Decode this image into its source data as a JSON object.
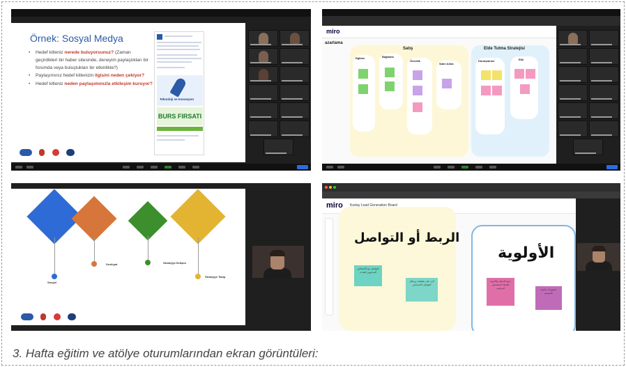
{
  "caption": "3. Hafta eğitim ve atölye oturumlarından ekran görüntüleri:",
  "shot1": {
    "title_prefix": "Örnek:",
    "title_main": "Sosyal Medya",
    "bullets": [
      {
        "pre": "Hedef kitleniz ",
        "hl": "nerede buluyorsunuz?",
        "post": " (Zaman geçirdikleri bir haber sitesinde, deneyim paylaştıkları bir forumda veya buluştukları bir etkinlikte?)"
      },
      {
        "pre": "Paylaşımınız hedef kitlenizin ",
        "hl": "ilgisini neden çekiyor?",
        "post": ""
      },
      {
        "pre": "Hedef kitleniz ",
        "hl": "neden paylaşımınızla etkileşim kuruyor?",
        "post": ""
      }
    ],
    "post_rocket_text": "Teknoloji ve Inovasyon",
    "post_banner": "BURS FIRSATI"
  },
  "shot2": {
    "logo": "miro",
    "columns": [
      "Satış",
      "Elde Tutma Stratejisi"
    ],
    "subcolumns": [
      "Eğitme",
      "Bağlama",
      "Önerilik",
      "Satın Alma",
      "Dönüştürme",
      "Etki"
    ],
    "left_heading": "azarlama",
    "sticky_colors": [
      "#7fd36f",
      "#f4e36a",
      "#c9a3e8",
      "#f49ac1",
      "#a5c8f0"
    ]
  },
  "shot3": {
    "cube_colors": [
      "#2e6bd6",
      "#d6763a",
      "#3c8f2c",
      "#e2b431"
    ],
    "labels": [
      "Sosyal",
      "Sevkiyat",
      "Stratejiye İletişim",
      "Stratejiye Takip"
    ],
    "dot_colors": [
      "#2e6bd6",
      "#d6763a",
      "#3c8f2c",
      "#e2b431"
    ]
  },
  "shot4": {
    "logo": "miro",
    "board_name": "Kurtay Lead Generation Board",
    "heading_left": "الربط أو التواصل",
    "heading_right": "الأولوية",
    "note1": "التواصل مع الأشخاص المدعوين للحدث",
    "note2": "الرد على تعليقات وسائل التواصل الاجتماعي",
    "note3": "جمع الأسئلة والأجوبة للعملاء المحتملين المرغوب",
    "note4": "خصومات خاصة بالموسم",
    "note_colors": [
      "#6dd3c2",
      "#7dd6c8",
      "#e06fa8",
      "#c06bb8"
    ]
  }
}
